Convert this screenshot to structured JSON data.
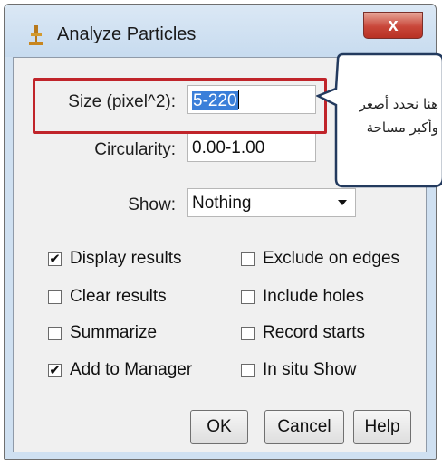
{
  "window": {
    "title": "Analyze Particles",
    "close_glyph": "x"
  },
  "fields": {
    "size": {
      "label": "Size (pixel^2):",
      "value": "5-220"
    },
    "circularity": {
      "label": "Circularity:",
      "value": "0.00-1.00"
    },
    "show": {
      "label": "Show:",
      "value": "Nothing"
    }
  },
  "annotation": {
    "line1": "هنا نحدد أصغر",
    "line2": "وأكبر مساحة"
  },
  "checkboxes": {
    "display_results": {
      "label": "Display results",
      "checked": true
    },
    "clear_results": {
      "label": "Clear results",
      "checked": false
    },
    "summarize": {
      "label": "Summarize",
      "checked": false
    },
    "add_to_manager": {
      "label": "Add to Manager",
      "checked": true
    },
    "exclude_on_edges": {
      "label": "Exclude on edges",
      "checked": false
    },
    "include_holes": {
      "label": "Include holes",
      "checked": false
    },
    "record_starts": {
      "label": "Record starts",
      "checked": false
    },
    "in_situ_show": {
      "label": "In situ Show",
      "checked": false
    }
  },
  "buttons": {
    "ok": "OK",
    "cancel": "Cancel",
    "help": "Help"
  },
  "colors": {
    "highlight_border": "#c0242a",
    "callout_border": "#233a5e",
    "selection": "#3b7fd9"
  }
}
